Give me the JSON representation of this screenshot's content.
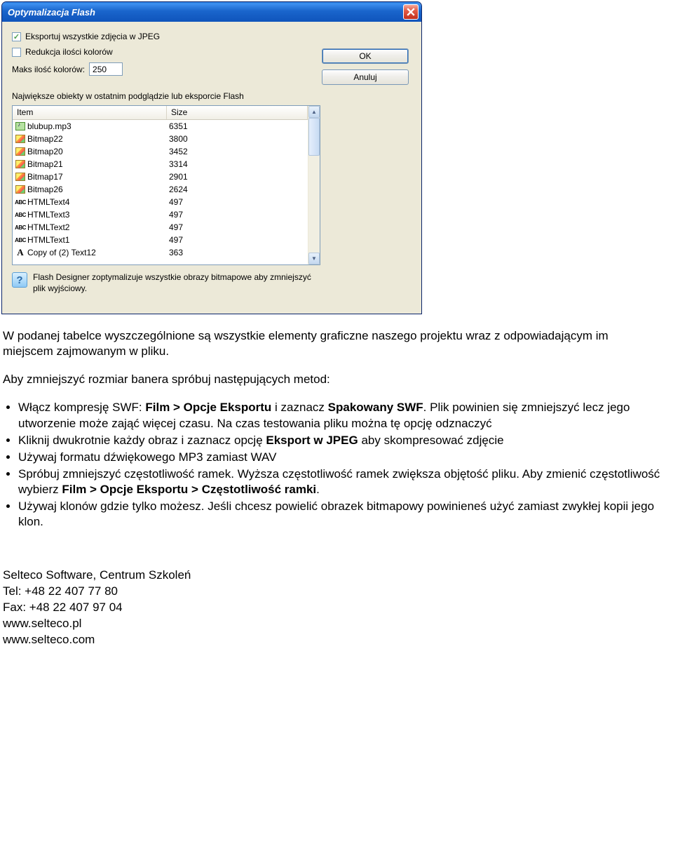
{
  "dialog": {
    "title": "Optymalizacja Flash",
    "close_icon": "close",
    "checkbox_export_label": "Eksportuj wszystkie zdjęcia w JPEG",
    "checkbox_export_checked": "✓",
    "checkbox_reduce_label": "Redukcja ilości kolorów",
    "max_colors_label": "Maks ilość kolorów:",
    "max_colors_value": "250",
    "ok_label": "OK",
    "cancel_label": "Anuluj",
    "section_label": "Największe obiekty w ostatnim podglądzie lub eksporcie Flash",
    "columns": {
      "item": "Item",
      "size": "Size"
    },
    "rows": [
      {
        "icon": "sound",
        "name": "blubup.mp3",
        "size": "6351"
      },
      {
        "icon": "bitmap",
        "name": "Bitmap22",
        "size": "3800"
      },
      {
        "icon": "bitmap",
        "name": "Bitmap20",
        "size": "3452"
      },
      {
        "icon": "bitmap",
        "name": "Bitmap21",
        "size": "3314"
      },
      {
        "icon": "bitmap",
        "name": "Bitmap17",
        "size": "2901"
      },
      {
        "icon": "bitmap",
        "name": "Bitmap26",
        "size": "2624"
      },
      {
        "icon": "abc",
        "name": "HTMLText4",
        "size": "497"
      },
      {
        "icon": "abc",
        "name": "HTMLText3",
        "size": "497"
      },
      {
        "icon": "abc",
        "name": "HTMLText2",
        "size": "497"
      },
      {
        "icon": "abc",
        "name": "HTMLText1",
        "size": "497"
      },
      {
        "icon": "font",
        "name": "Copy of (2) Text12",
        "size": "363"
      }
    ],
    "hint_text": "Flash Designer zoptymalizuje wszystkie obrazy bitmapowe aby zmniejszyć plik wyjściowy."
  },
  "article": {
    "p1": "W podanej tabelce wyszczególnione są wszystkie elementy graficzne naszego projektu wraz z odpowiadającym im miejscem zajmowanym w pliku.",
    "p2": "Aby zmniejszyć rozmiar banera spróbuj następujących metod:",
    "bullets": {
      "b0a": "Włącz kompresję SWF: ",
      "b0b": "Film > Opcje Eksportu",
      "b0c": " i zaznacz ",
      "b0d": "Spakowany SWF",
      "b0e": ". Plik powinien się zmniejszyć lecz jego utworzenie może zająć więcej czasu. Na czas testowania pliku można tę opcję odznaczyć",
      "b1a": "Kliknij dwukrotnie każdy obraz i zaznacz opcję ",
      "b1b": "Eksport w JPEG",
      "b1c": " aby skompresować zdjęcie",
      "b2": "Używaj formatu dźwiękowego MP3 zamiast WAV",
      "b3a": "Spróbuj zmniejszyć częstotliwość ramek. Wyższa częstotliwość ramek zwiększa objętość pliku. Aby zmienić częstotliwość wybierz ",
      "b3b": "Film > Opcje Eksportu > Częstotliwość ramki",
      "b3c": ".",
      "b4": "Używaj klonów gdzie tylko możesz. Jeśli chcesz powielić obrazek bitmapowy powinieneś użyć zamiast zwykłej kopii jego klon."
    }
  },
  "footer": {
    "l1": "Selteco Software, Centrum Szkoleń",
    "l2": "Tel: +48 22 407 77 80",
    "l3": "Fax: +48 22 407 97 04",
    "l4": "www.selteco.pl",
    "l5": "www.selteco.com"
  }
}
